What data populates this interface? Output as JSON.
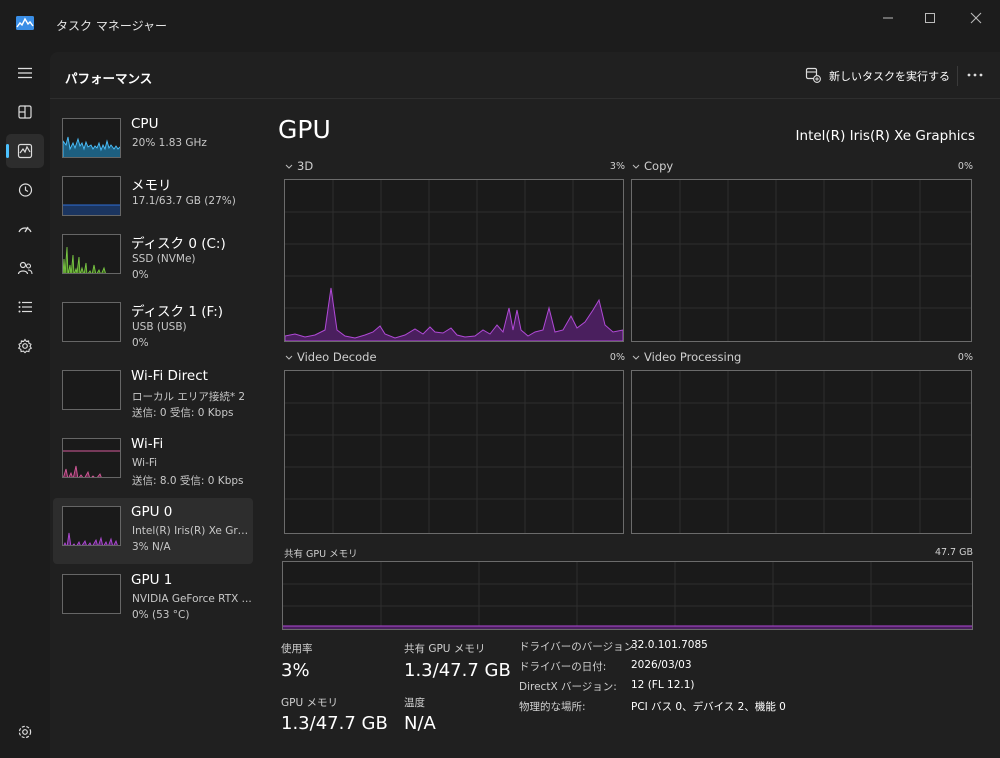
{
  "window": {
    "title": "タスク マネージャー"
  },
  "header": {
    "page_title": "パフォーマンス",
    "new_task_label": "新しいタスクを実行する"
  },
  "rail": {
    "items": [
      "menu-icon",
      "processes-icon",
      "performance-icon",
      "app-history-icon",
      "startup-apps-icon",
      "users-icon",
      "details-icon",
      "services-icon",
      "settings-icon"
    ],
    "active": "performance-icon"
  },
  "devices": [
    {
      "name": "CPU",
      "line1": "20%  1.83 GHz",
      "line2": "",
      "color": "#4cc2ff"
    },
    {
      "name": "メモリ",
      "line1": "17.1/63.7 GB (27%)",
      "line2": "",
      "color": "#2f6fd6"
    },
    {
      "name": "ディスク 0 (C:)",
      "line1": "SSD (NVMe)",
      "line2": "0%",
      "color": "#7ac943"
    },
    {
      "name": "ディスク 1 (F:)",
      "line1": "USB (USB)",
      "line2": "0%",
      "color": "#7ac943"
    },
    {
      "name": "Wi-Fi Direct",
      "line1": "ローカル エリア接続* 2",
      "line2": "送信: 0  受信: 0 Kbps",
      "color": "#d45a9a"
    },
    {
      "name": "Wi-Fi",
      "line1": "Wi-Fi",
      "line2": "送信: 8.0  受信: 0 Kbps",
      "color": "#d45a9a"
    },
    {
      "name": "GPU 0",
      "line1": "Intel(R) Iris(R) Xe Graphics",
      "line2": "3%  N/A",
      "color": "#b04ad6"
    },
    {
      "name": "GPU 1",
      "line1": "NVIDIA GeForce RTX ...",
      "line2": "0%  (53 °C)",
      "color": "#b04ad6"
    }
  ],
  "gpu": {
    "heading": "GPU",
    "model": "Intel(R) Iris(R) Xe Graphics",
    "engines": [
      {
        "label": "3D",
        "pct": "3%"
      },
      {
        "label": "Copy",
        "pct": "0%"
      },
      {
        "label": "Video Decode",
        "pct": "0%"
      },
      {
        "label": "Video Processing",
        "pct": "0%"
      }
    ],
    "shared_memory": {
      "label": "共有 GPU メモリ",
      "max": "47.7 GB"
    },
    "utilization": {
      "label": "使用率",
      "value": "3%"
    },
    "shared_mem_stat": {
      "label": "共有 GPU メモリ",
      "value": "1.3/47.7 GB"
    },
    "gpu_memory": {
      "label": "GPU メモリ",
      "value": "1.3/47.7 GB"
    },
    "temperature": {
      "label": "温度",
      "value": "N/A"
    },
    "info": [
      {
        "key": "ドライバーのバージョン:",
        "value": "32.0.101.7085"
      },
      {
        "key": "ドライバーの日付:",
        "value": "2026/03/03"
      },
      {
        "key": "DirectX バージョン:",
        "value": "12 (FL 12.1)"
      },
      {
        "key": "物理的な場所:",
        "value": "PCI バス 0、デバイス 2、機能 0"
      }
    ]
  }
}
